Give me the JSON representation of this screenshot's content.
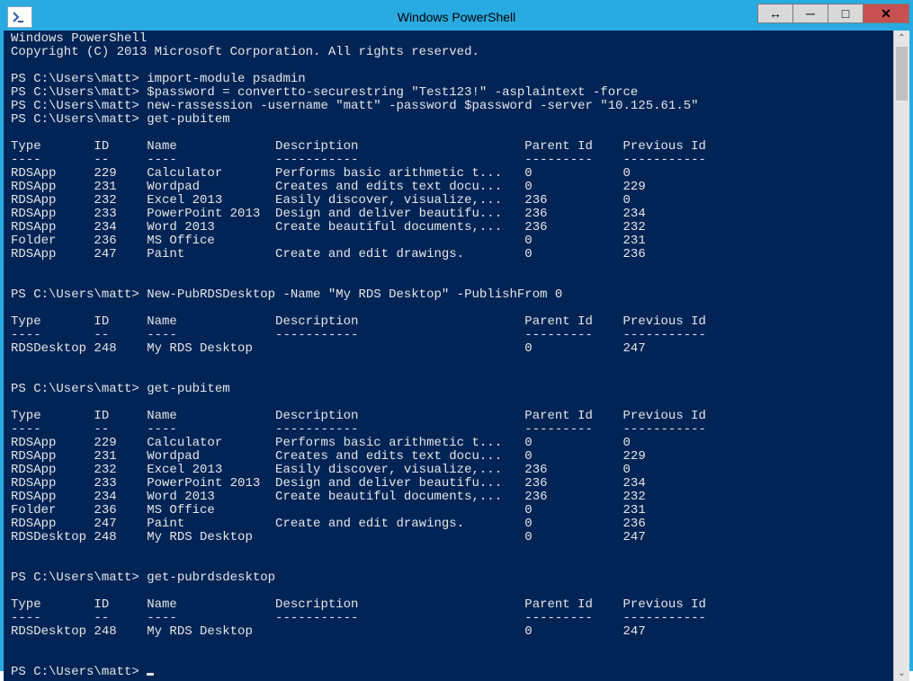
{
  "window": {
    "title": "Windows PowerShell"
  },
  "controls": {
    "resize_glyph": "↔",
    "min_glyph": "─",
    "max_glyph": "□",
    "close_glyph": "✕"
  },
  "scrollbar": {
    "up_glyph": "⌃",
    "down_glyph": "⌄"
  },
  "banner": {
    "line1": "Windows PowerShell",
    "line2": "Copyright (C) 2013 Microsoft Corporation. All rights reserved."
  },
  "prompt": "PS C:\\Users\\matt>",
  "commands": {
    "c1": "import-module psadmin",
    "c2": "$password = convertto-securestring \"Test123!\" -asplaintext -force",
    "c3": "new-rassession -username \"matt\" -password $password -server \"10.125.61.5\"",
    "c4": "get-pubitem",
    "c5": "New-PubRDSDesktop -Name \"My RDS Desktop\" -PublishFrom 0",
    "c6": "get-pubitem",
    "c7": "get-pubrdsdesktop",
    "c8": ""
  },
  "table_headers": {
    "type": "Type",
    "id": "ID",
    "name": "Name",
    "desc": "Description",
    "parent": "Parent Id",
    "prev": "Previous Id",
    "u_type": "----",
    "u_id": "--",
    "u_name": "----",
    "u_desc": "-----------",
    "u_parent": "---------",
    "u_prev": "-----------"
  },
  "tables": {
    "t1_header1": "Type       ID     Name             Description                      Parent Id    Previous Id",
    "t1_header2": "----       --     ----             -----------                      ---------    -----------",
    "t1_rows": [
      "RDSApp     229    Calculator       Performs basic arithmetic t...   0            0",
      "RDSApp     231    Wordpad          Creates and edits text docu...   0            229",
      "RDSApp     232    Excel 2013       Easily discover, visualize,...   236          0",
      "RDSApp     233    PowerPoint 2013  Design and deliver beautifu...   236          234",
      "RDSApp     234    Word 2013        Create beautiful documents,...   236          232",
      "Folder     236    MS Office                                         0            231",
      "RDSApp     247    Paint            Create and edit drawings.        0            236"
    ],
    "t2_rows": [
      "RDSDesktop 248    My RDS Desktop                                    0            247"
    ],
    "t3_rows": [
      "RDSApp     229    Calculator       Performs basic arithmetic t...   0            0",
      "RDSApp     231    Wordpad          Creates and edits text docu...   0            229",
      "RDSApp     232    Excel 2013       Easily discover, visualize,...   236          0",
      "RDSApp     233    PowerPoint 2013  Design and deliver beautifu...   236          234",
      "RDSApp     234    Word 2013        Create beautiful documents,...   236          232",
      "Folder     236    MS Office                                         0            231",
      "RDSApp     247    Paint            Create and edit drawings.        0            236",
      "RDSDesktop 248    My RDS Desktop                                    0            247"
    ],
    "t4_rows": [
      "RDSDesktop 248    My RDS Desktop                                    0            247"
    ]
  },
  "structured": {
    "items1": [
      {
        "type": "RDSApp",
        "id": 229,
        "name": "Calculator",
        "desc": "Performs basic arithmetic t...",
        "parent": 0,
        "prev": 0
      },
      {
        "type": "RDSApp",
        "id": 231,
        "name": "Wordpad",
        "desc": "Creates and edits text docu...",
        "parent": 0,
        "prev": 229
      },
      {
        "type": "RDSApp",
        "id": 232,
        "name": "Excel 2013",
        "desc": "Easily discover, visualize,...",
        "parent": 236,
        "prev": 0
      },
      {
        "type": "RDSApp",
        "id": 233,
        "name": "PowerPoint 2013",
        "desc": "Design and deliver beautifu...",
        "parent": 236,
        "prev": 234
      },
      {
        "type": "RDSApp",
        "id": 234,
        "name": "Word 2013",
        "desc": "Create beautiful documents,...",
        "parent": 236,
        "prev": 232
      },
      {
        "type": "Folder",
        "id": 236,
        "name": "MS Office",
        "desc": "",
        "parent": 0,
        "prev": 231
      },
      {
        "type": "RDSApp",
        "id": 247,
        "name": "Paint",
        "desc": "Create and edit drawings.",
        "parent": 0,
        "prev": 236
      }
    ],
    "items2": [
      {
        "type": "RDSDesktop",
        "id": 248,
        "name": "My RDS Desktop",
        "desc": "",
        "parent": 0,
        "prev": 247
      }
    ],
    "items3_extra": [
      {
        "type": "RDSDesktop",
        "id": 248,
        "name": "My RDS Desktop",
        "desc": "",
        "parent": 0,
        "prev": 247
      }
    ],
    "items4": [
      {
        "type": "RDSDesktop",
        "id": 248,
        "name": "My RDS Desktop",
        "desc": "",
        "parent": 0,
        "prev": 247
      }
    ]
  }
}
